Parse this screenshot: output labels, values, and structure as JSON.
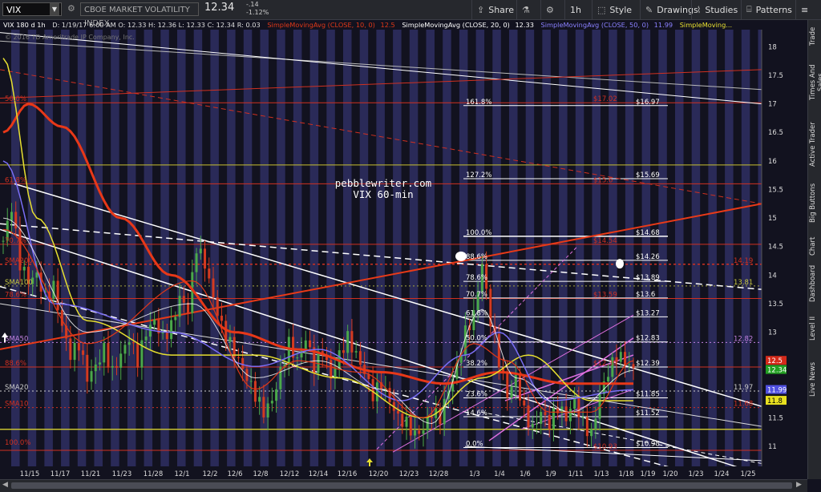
{
  "toolbar": {
    "symbol": "VIX",
    "security_name": "CBOE MARKET VOLATILITY INDEX",
    "last": "12.34",
    "change": "-.14",
    "change_pct": "-1.12%",
    "share": "Share",
    "aggregation": "1h",
    "style": "Style",
    "drawings": "Drawings",
    "studies": "Studies",
    "patterns": "Patterns"
  },
  "legend": {
    "symbol_line": "VIX 180 d 1h",
    "ohlc": "D: 1/19/17 6:00 AM   O: 12.33   H: 12.36   L: 12.33   C: 12.34   R: 0.03",
    "sma10": "SimpleMovingAvg (CLOSE, 10, 0)",
    "sma10_val": "12.5",
    "sma20": "SimpleMovingAvg (CLOSE, 20, 0)",
    "sma20_val": "12.33",
    "sma50": "SimpleMovingAvg (CLOSE, 50, 0)",
    "sma50_val": "11.99",
    "sma100": "SimpleMoving...",
    "copyright": "© 2016 TD Ameritrade IP Company, Inc."
  },
  "watermark": {
    "line1": "pebblewriter.com",
    "line2": "VIX 60-min"
  },
  "colors": {
    "bg": "#12121f",
    "band": "#2e2e5e",
    "up": "#4aa84a",
    "down": "#d43a20",
    "sma10": "#e03818",
    "sma20": "#ffffff",
    "sma50": "#7a6ef5",
    "sma100": "#e8e030",
    "fib": "#ffffff",
    "red_line": "#d03020",
    "magenta": "#e070e0"
  },
  "sidebar": [
    "Trade",
    "Times And Sales",
    "Active Trader",
    "Big Buttons",
    "Chart",
    "Dashboard",
    "Level II",
    "Live News"
  ],
  "chart_data": {
    "type": "candlestick",
    "symbol": "VIX",
    "timeframe": "60-min",
    "ylim": [
      10.65,
      18.3
    ],
    "yticks": [
      11,
      11.5,
      12,
      12.5,
      13,
      13.5,
      14,
      14.5,
      15,
      15.5,
      16,
      16.5,
      17,
      17.5,
      18
    ],
    "ytick_labels": [
      "11",
      "11.5",
      "12",
      "12.5",
      "13",
      "13.5",
      "14",
      "14.5",
      "15",
      "15.5",
      "16",
      "16.5",
      "17",
      "17.5",
      "18"
    ],
    "x_dates": [
      "11/15",
      "11/17",
      "11/21",
      "11/23",
      "11/28",
      "12/1",
      "12/2",
      "12/6",
      "12/8",
      "12/12",
      "12/14",
      "12/16",
      "12/20",
      "12/23",
      "12/28",
      "1/3",
      "1/4",
      "1/6",
      "1/9",
      "1/11",
      "1/13",
      "1/18",
      "1/19",
      "1/20",
      "1/23",
      "1/24",
      "1/25"
    ],
    "close_path": [
      [
        0,
        14.6
      ],
      [
        2,
        15.2
      ],
      [
        4,
        14.2
      ],
      [
        6,
        13.9
      ],
      [
        8,
        14.0
      ],
      [
        10,
        13.6
      ],
      [
        12,
        13.8
      ],
      [
        14,
        13.1
      ],
      [
        16,
        12.6
      ],
      [
        18,
        12.8
      ],
      [
        20,
        12.2
      ],
      [
        22,
        12.4
      ],
      [
        24,
        12.7
      ],
      [
        26,
        12.3
      ],
      [
        28,
        12.6
      ],
      [
        30,
        12.9
      ],
      [
        32,
        12.5
      ],
      [
        34,
        13.0
      ],
      [
        36,
        13.2
      ],
      [
        38,
        12.9
      ],
      [
        40,
        13.1
      ],
      [
        42,
        13.6
      ],
      [
        44,
        13.4
      ],
      [
        46,
        14.5
      ],
      [
        48,
        14.2
      ],
      [
        50,
        13.6
      ],
      [
        52,
        13.1
      ],
      [
        54,
        12.8
      ],
      [
        56,
        12.5
      ],
      [
        58,
        12.2
      ],
      [
        60,
        11.9
      ],
      [
        62,
        11.6
      ],
      [
        64,
        11.8
      ],
      [
        66,
        12.3
      ],
      [
        68,
        12.8
      ],
      [
        70,
        12.5
      ],
      [
        72,
        12.9
      ],
      [
        74,
        12.4
      ],
      [
        76,
        12.7
      ],
      [
        78,
        12.2
      ],
      [
        80,
        12.6
      ],
      [
        82,
        12.9
      ],
      [
        84,
        12.6
      ],
      [
        86,
        12.3
      ],
      [
        88,
        11.9
      ],
      [
        90,
        12.1
      ],
      [
        92,
        11.8
      ],
      [
        94,
        11.5
      ],
      [
        96,
        11.4
      ],
      [
        98,
        11.2
      ],
      [
        100,
        11.3
      ],
      [
        102,
        11.6
      ],
      [
        104,
        11.5
      ],
      [
        106,
        12.0
      ],
      [
        108,
        12.4
      ],
      [
        110,
        13.0
      ],
      [
        112,
        13.3
      ],
      [
        114,
        14.2
      ],
      [
        116,
        13.2
      ],
      [
        118,
        12.5
      ],
      [
        120,
        11.9
      ],
      [
        122,
        12.2
      ],
      [
        124,
        11.6
      ],
      [
        126,
        11.3
      ],
      [
        128,
        11.6
      ],
      [
        130,
        11.4
      ],
      [
        132,
        11.7
      ],
      [
        134,
        11.5
      ],
      [
        136,
        11.8
      ],
      [
        138,
        11.4
      ],
      [
        140,
        11.2
      ],
      [
        142,
        11.9
      ],
      [
        144,
        12.3
      ],
      [
        146,
        12.6
      ],
      [
        148,
        12.5
      ],
      [
        150,
        12.34
      ]
    ],
    "n_bars": 151,
    "sma10": [
      [
        0,
        14.8
      ],
      [
        20,
        12.8
      ],
      [
        45,
        13.9
      ],
      [
        60,
        12.0
      ],
      [
        70,
        12.5
      ],
      [
        85,
        12.3
      ],
      [
        100,
        11.5
      ],
      [
        112,
        12.8
      ],
      [
        120,
        12.5
      ],
      [
        130,
        11.6
      ],
      [
        140,
        11.6
      ],
      [
        150,
        12.5
      ]
    ],
    "sma20": [
      [
        0,
        15.0
      ],
      [
        20,
        13.0
      ],
      [
        45,
        13.5
      ],
      [
        60,
        12.2
      ],
      [
        75,
        12.5
      ],
      [
        90,
        12.0
      ],
      [
        102,
        11.4
      ],
      [
        114,
        13.4
      ],
      [
        122,
        12.2
      ],
      [
        135,
        11.6
      ],
      [
        150,
        12.33
      ]
    ],
    "sma50": [
      [
        0,
        16.0
      ],
      [
        12,
        13.5
      ],
      [
        40,
        13.0
      ],
      [
        60,
        12.4
      ],
      [
        75,
        12.7
      ],
      [
        95,
        11.8
      ],
      [
        110,
        12.6
      ],
      [
        118,
        13.0
      ],
      [
        130,
        11.8
      ],
      [
        150,
        11.99
      ]
    ],
    "sma100": [
      [
        0,
        17.8
      ],
      [
        8,
        15.0
      ],
      [
        20,
        13.2
      ],
      [
        40,
        12.6
      ],
      [
        60,
        12.6
      ],
      [
        80,
        12.2
      ],
      [
        100,
        11.5
      ],
      [
        114,
        12.2
      ],
      [
        125,
        12.6
      ],
      [
        140,
        11.8
      ],
      [
        150,
        11.8
      ]
    ],
    "sma_red_long": [
      [
        0,
        16.5
      ],
      [
        6,
        17.0
      ],
      [
        14,
        16.6
      ],
      [
        28,
        15.0
      ],
      [
        40,
        14.0
      ],
      [
        55,
        13.0
      ],
      [
        70,
        12.7
      ],
      [
        90,
        12.3
      ],
      [
        105,
        12.1
      ],
      [
        118,
        12.3
      ],
      [
        135,
        12.1
      ],
      [
        150,
        12.1
      ]
    ],
    "fib_levels": [
      {
        "pct": "161.8%",
        "value": "$16.97",
        "y": 16.97
      },
      {
        "pct": "127.2%",
        "value": "$15.69",
        "y": 15.69
      },
      {
        "pct": "100.0%",
        "value": "$14.68",
        "y": 14.68
      },
      {
        "pct": "88.6%",
        "value": "$14.26",
        "y": 14.26
      },
      {
        "pct": "78.6%",
        "value": "$13.89",
        "y": 13.89
      },
      {
        "pct": "70.7%",
        "value": "$13.6",
        "y": 13.6
      },
      {
        "pct": "61.8%",
        "value": "$13.27",
        "y": 13.27
      },
      {
        "pct": "50.0%",
        "value": "$12.83",
        "y": 12.83
      },
      {
        "pct": "38.2%",
        "value": "$12.39",
        "y": 12.39
      },
      {
        "pct": "23.6%",
        "value": "$11.85",
        "y": 11.85
      },
      {
        "pct": "14.6%",
        "value": "$11.52",
        "y": 11.52
      },
      {
        "pct": "0.0%",
        "value": "$10.98",
        "y": 10.98
      }
    ],
    "red_fib": [
      {
        "label": "$17.02",
        "y": 17.02
      },
      {
        "label": "$15.6",
        "y": 15.6
      },
      {
        "label": "$14.54",
        "y": 14.54
      },
      {
        "label": "$13.59",
        "y": 13.59
      },
      {
        "label": "$12.39",
        "y": 12.39
      },
      {
        "label": "$10.93",
        "y": 10.93
      }
    ],
    "left_labels": [
      {
        "text": "50.0%",
        "y": 17.02,
        "color": "#d03020"
      },
      {
        "text": "61.8%",
        "y": 15.6,
        "color": "#d03020"
      },
      {
        "text": "70.7%",
        "y": 14.54,
        "color": "#d03020"
      },
      {
        "text": "SMA200",
        "y": 14.19,
        "color": "#d03020"
      },
      {
        "text": "SMA100",
        "y": 13.81,
        "color": "#c8c840"
      },
      {
        "text": "78.6%",
        "y": 13.59,
        "color": "#d03020"
      },
      {
        "text": "SMA50",
        "y": 12.82,
        "color": "#c080e0"
      },
      {
        "text": "88.6%",
        "y": 12.39,
        "color": "#d03020"
      },
      {
        "text": "SMA20",
        "y": 11.97,
        "color": "#cccccc"
      },
      {
        "text": "SMA10",
        "y": 11.68,
        "color": "#d03020"
      },
      {
        "text": "100.0%",
        "y": 11.0,
        "color": "#d03020"
      }
    ],
    "right_labels": [
      {
        "text": "14.19",
        "y": 14.19,
        "color": "#d03020"
      },
      {
        "text": "13.81",
        "y": 13.81,
        "color": "#c8c840"
      },
      {
        "text": "12.82",
        "y": 12.82,
        "color": "#c080e0"
      },
      {
        "text": "11.97",
        "y": 11.97,
        "color": "#cccccc"
      },
      {
        "text": "11.68",
        "y": 11.68,
        "color": "#d03020"
      }
    ],
    "axis_markers": [
      {
        "text": "12.5",
        "y": 12.5,
        "bg": "#d42a1a",
        "fg": "#ffffff"
      },
      {
        "text": "12.34",
        "y": 12.34,
        "bg": "#22a022",
        "fg": "#ffffff"
      },
      {
        "text": "11.99",
        "y": 11.99,
        "bg": "#5050e0",
        "fg": "#ffffff"
      },
      {
        "text": "11.8",
        "y": 11.8,
        "bg": "#e8e020",
        "fg": "#000000"
      }
    ]
  }
}
